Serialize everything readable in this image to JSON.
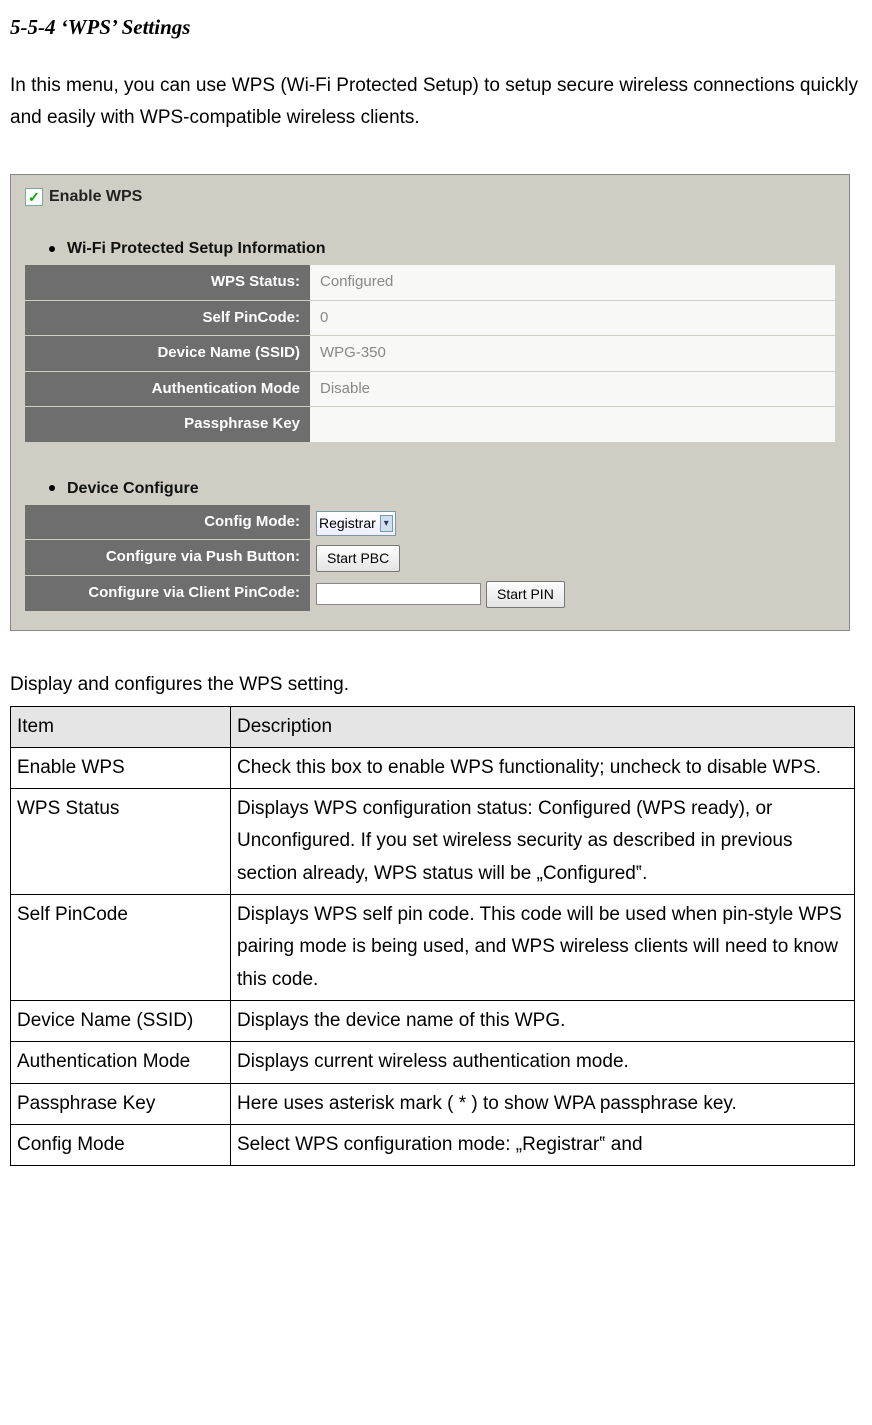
{
  "title": "5-5-4 ‘WPS’ Settings",
  "intro": "In this menu, you can use WPS (Wi-Fi Protected Setup) to setup secure wireless connections quickly and easily with WPS-compatible wireless clients.",
  "panel": {
    "enable_check": "✓",
    "enable_label": "Enable WPS",
    "group1": "Wi-Fi Protected Setup Information",
    "rows1": [
      {
        "label": "WPS Status:",
        "value": "Configured"
      },
      {
        "label": "Self PinCode:",
        "value": "0"
      },
      {
        "label": "Device Name (SSID)",
        "value": "WPG-350"
      },
      {
        "label": "Authentication Mode",
        "value": "Disable"
      },
      {
        "label": "Passphrase Key",
        "value": ""
      }
    ],
    "group2": "Device Configure",
    "config_mode_label": "Config Mode:",
    "config_mode_value": "Registrar",
    "push_label": "Configure via Push Button:",
    "push_btn": "Start PBC",
    "pin_label": "Configure via Client PinCode:",
    "pin_btn": "Start PIN"
  },
  "desc_caption": "Display and configures the WPS setting.",
  "desc_headers": {
    "item": "Item",
    "description": "Description"
  },
  "desc_rows": [
    {
      "item": "Enable WPS",
      "desc": "Check this box to enable WPS functionality; uncheck to disable WPS."
    },
    {
      "item": "WPS Status",
      "desc": "Displays WPS configuration status: Configured (WPS ready), or Unconfigured. If you set wireless security as described in previous section already, WPS status will be „Configured‟."
    },
    {
      "item": "Self PinCode",
      "desc": "Displays WPS self pin code. This code will be used when pin-style WPS pairing mode is being used, and WPS wireless clients will need to know this code."
    },
    {
      "item": "Device Name (SSID)",
      "desc": "Displays the device name of this WPG."
    },
    {
      "item": "Authentication Mode",
      "desc": "Displays current wireless authentication mode."
    },
    {
      "item": "Passphrase Key",
      "desc": "Here uses asterisk mark ( * ) to show WPA passphrase key."
    },
    {
      "item": "Config Mode",
      "desc": "Select WPS configuration mode: „Registrar‟ and"
    }
  ]
}
